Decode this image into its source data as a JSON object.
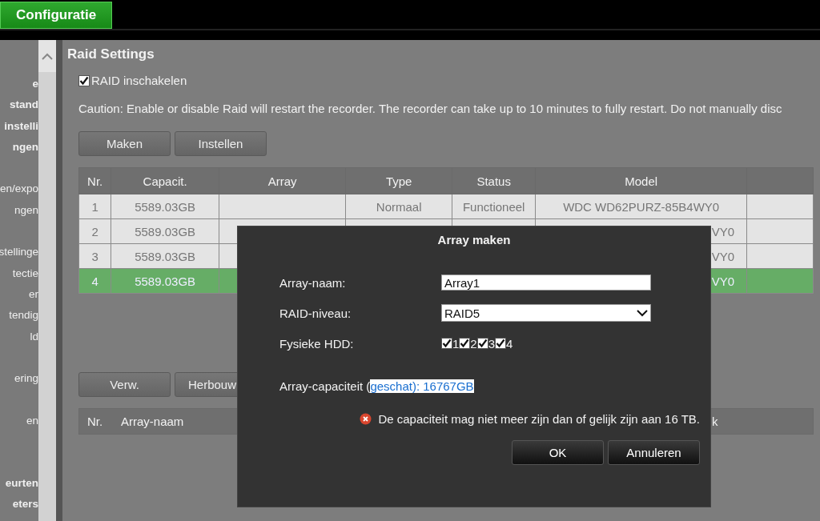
{
  "top_bar": {
    "tabs": [
      {
        "label": "Configuratie",
        "selected": true
      }
    ]
  },
  "sidebar": {
    "sections": [
      {
        "items": [
          {
            "label": "e",
            "kind": "heading"
          },
          {
            "label": "stand",
            "kind": "heading"
          },
          {
            "label": "instelli",
            "kind": "heading"
          },
          {
            "label": "ngen",
            "kind": "heading"
          }
        ]
      },
      {
        "items": [
          {
            "label": "en/expo",
            "kind": "entry"
          },
          {
            "label": "ngen",
            "kind": "entry"
          }
        ]
      },
      {
        "items": [
          {
            "label": "stellinge",
            "kind": "entry"
          },
          {
            "label": "tectie",
            "kind": "entry"
          },
          {
            "label": "er",
            "kind": "entry"
          },
          {
            "label": "tendig",
            "kind": "entry"
          },
          {
            "label": "ld",
            "kind": "entry"
          }
        ]
      },
      {
        "items": [
          {
            "label": "ering",
            "kind": "entry"
          }
        ]
      },
      {
        "items": [
          {
            "label": "en",
            "kind": "entry"
          }
        ]
      },
      {
        "items": [
          {
            "label": "eurten",
            "kind": "heading"
          },
          {
            "label": "eters",
            "kind": "heading"
          }
        ]
      }
    ]
  },
  "page": {
    "title": "Raid Settings",
    "enable_raid": {
      "label": "RAID inschakelen",
      "checked": true
    },
    "caution": "Caution: Enable or disable Raid will restart the recorder. The recorder can take up to 10 minutes to fully restart. Do not manually disc",
    "disk_buttons": [
      "Maken",
      "Instellen"
    ],
    "disk_table": {
      "columns": [
        "Nr.",
        "Capacit.",
        "Array",
        "Type",
        "Status",
        "Model"
      ],
      "rows": [
        {
          "nr": "1",
          "capacity": "5589.03GB",
          "type": "Normaal",
          "status": "Functioneel",
          "model": "WDC WD62PURZ-85B4WY0",
          "selected": false
        },
        {
          "nr": "2",
          "capacity": "5589.03GB",
          "model": "VY0",
          "selected": false
        },
        {
          "nr": "3",
          "capacity": "5589.03GB",
          "model": "VY0",
          "selected": false
        },
        {
          "nr": "4",
          "capacity": "5589.03GB",
          "model": "VY0",
          "selected": true
        }
      ]
    },
    "array_buttons": [
      "Verw.",
      "Herbouw"
    ],
    "array_table": {
      "columns": [
        "Nr.",
        "Array-naam",
        "k"
      ]
    }
  },
  "dialog": {
    "title": "Array maken",
    "array_name": {
      "label": "Array-naam:",
      "value": "Array1"
    },
    "raid_level": {
      "label": "RAID-niveau:",
      "value": "RAID5"
    },
    "hdds": {
      "label": "Fysieke HDD:",
      "disks": [
        {
          "label": "1",
          "checked": true
        },
        {
          "label": "2",
          "checked": true
        },
        {
          "label": "3",
          "checked": true
        },
        {
          "label": "4",
          "checked": true
        }
      ]
    },
    "capacity": {
      "text": "Array-capaciteit (",
      "selected_text": "geschat): 16767GB"
    },
    "error": "De capaciteit mag niet meer zijn dan of gelijk zijn aan 16 TB.",
    "buttons": [
      "OK",
      "Annuleren"
    ]
  }
}
